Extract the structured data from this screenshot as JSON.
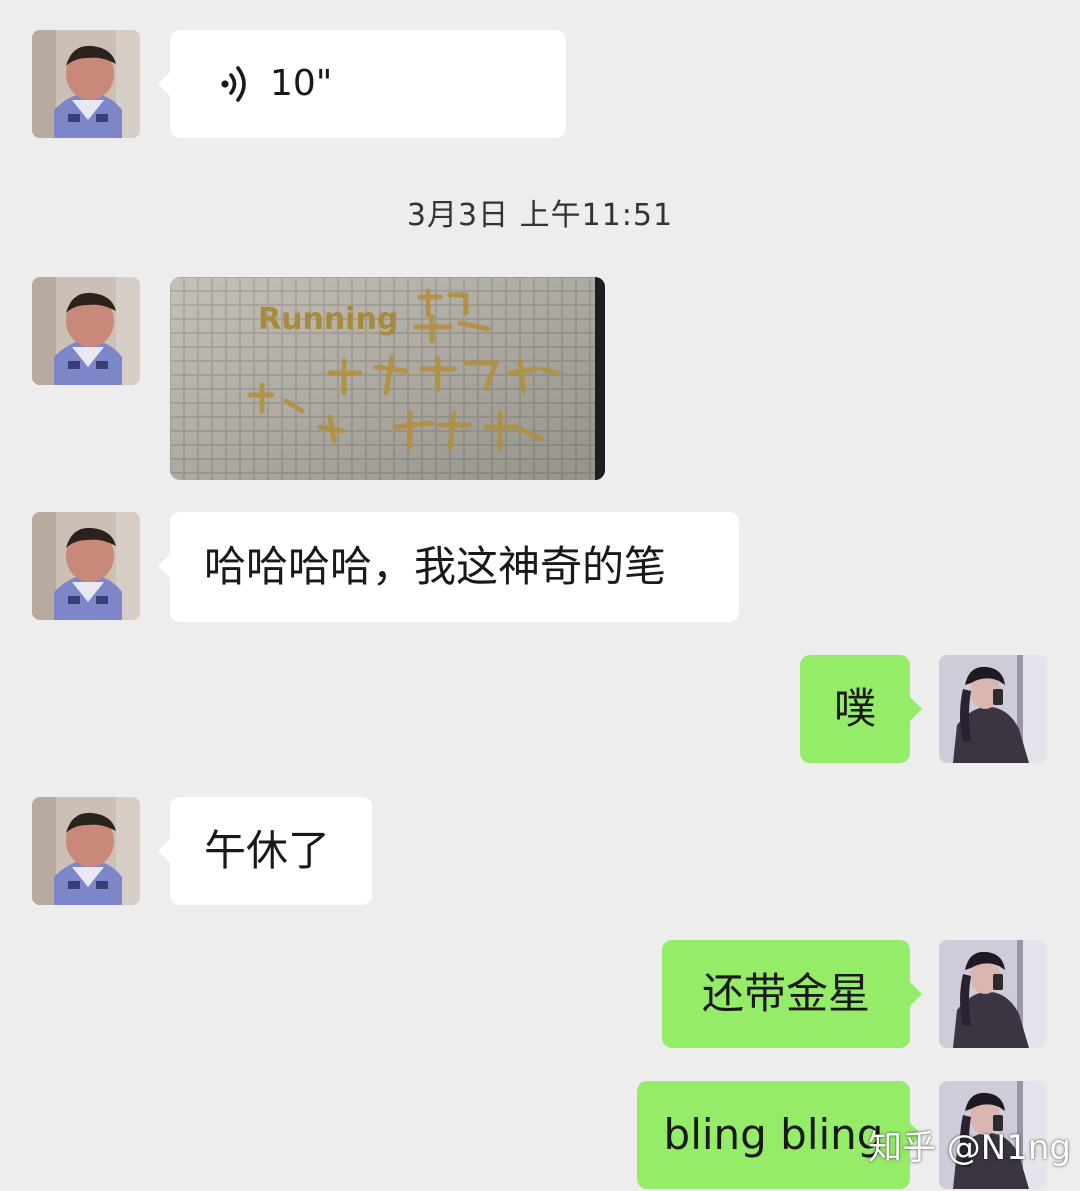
{
  "chat": {
    "voice": {
      "duration": "10\""
    },
    "timestamp": "3月3日 上午11:51",
    "image_text": "Running",
    "messages": {
      "m1": "哈哈哈哈，我这神奇的笔",
      "m2": "噗",
      "m3": "午休了",
      "m4": "还带金星",
      "m5": "bling bling"
    }
  },
  "watermark": "知乎 @N1ng",
  "colors": {
    "background": "#ededed",
    "incoming_bubble": "#ffffff",
    "outgoing_bubble": "#95ec69"
  }
}
